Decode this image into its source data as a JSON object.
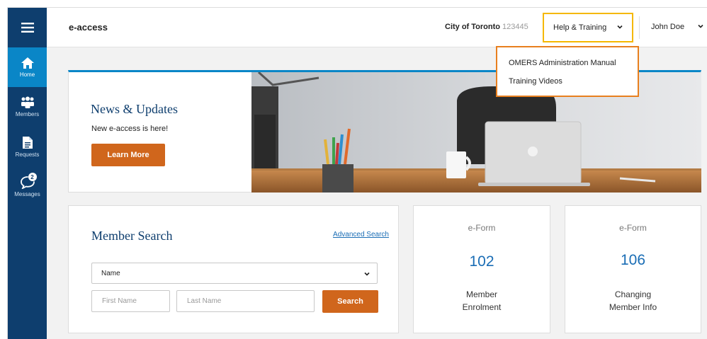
{
  "header": {
    "logo": "e-access",
    "org_name": "City of Toronto",
    "org_id": "123445",
    "help_label": "Help & Training",
    "user_name": "John Doe"
  },
  "help_menu": {
    "items": [
      "OMERS Administration Manual",
      "Training Videos"
    ]
  },
  "sidebar": {
    "items": [
      {
        "label": "Home",
        "icon": "home-icon",
        "active": true
      },
      {
        "label": "Members",
        "icon": "members-icon"
      },
      {
        "label": "Requests",
        "icon": "document-icon"
      },
      {
        "label": "Messages",
        "icon": "chat-icon",
        "badge": "2"
      }
    ]
  },
  "news": {
    "title": "News & Updates",
    "subtitle": "New e-access is here!",
    "button": "Learn More"
  },
  "member_search": {
    "title": "Member Search",
    "advanced_link": "Advanced Search",
    "select_value": "Name",
    "first_name_placeholder": "First Name",
    "last_name_placeholder": "Last Name",
    "search_button": "Search"
  },
  "eforms": [
    {
      "label": "e-Form",
      "count": "102",
      "line1": "Member",
      "line2": "Enrolment"
    },
    {
      "label": "e-Form",
      "count": "106",
      "line1": "Changing",
      "line2": "Member Info"
    }
  ],
  "colors": {
    "sidebar": "#0e3e6e",
    "active_nav": "#0a86c7",
    "accent_orange": "#d0661c",
    "help_highlight": "#f5b800",
    "dropdown_border": "#e87f1e",
    "link_blue": "#1a6db5"
  }
}
